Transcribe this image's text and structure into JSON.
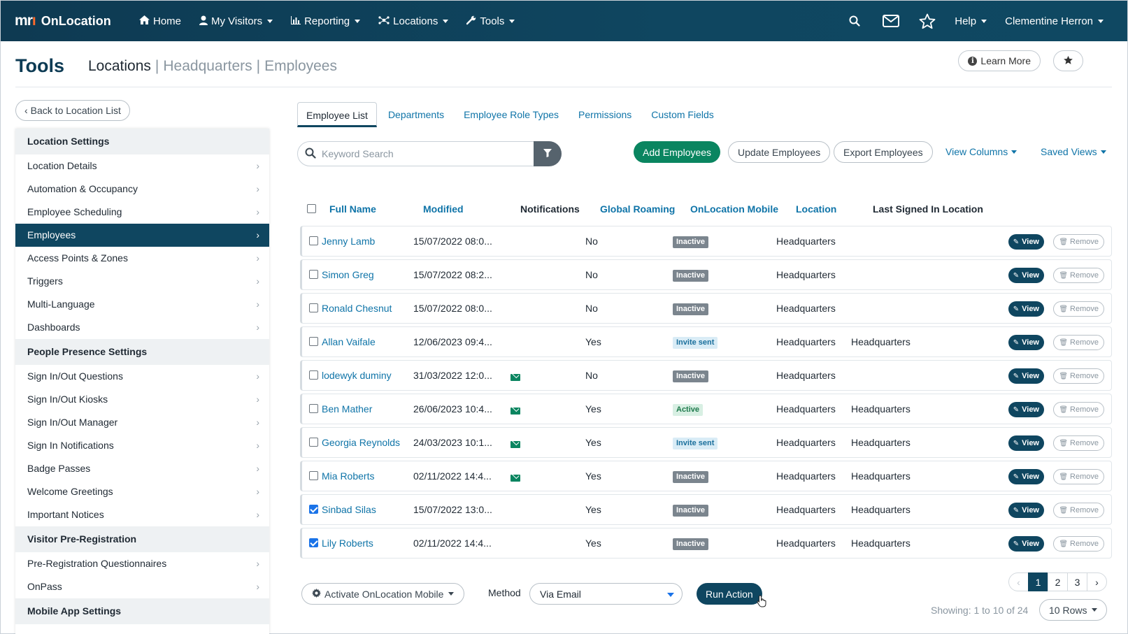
{
  "nav": {
    "brand_logo": "mri",
    "brand_name": "OnLocation",
    "items": [
      {
        "label": "Home",
        "icon": "home-icon",
        "dropdown": false
      },
      {
        "label": "My Visitors",
        "icon": "user-icon",
        "dropdown": true
      },
      {
        "label": "Reporting",
        "icon": "bar-chart-icon",
        "dropdown": true
      },
      {
        "label": "Locations",
        "icon": "network-icon",
        "dropdown": true
      },
      {
        "label": "Tools",
        "icon": "wrench-icon",
        "dropdown": true
      }
    ],
    "help_label": "Help",
    "user_name": "Clementine Herron"
  },
  "header": {
    "title": "Tools",
    "crumb_current": "Locations",
    "crumb_location": "Headquarters",
    "crumb_section": "Employees",
    "learn_more": "Learn More"
  },
  "sidebar": {
    "back_label": "Back to Location List",
    "groups": [
      {
        "heading": "Location Settings",
        "items": [
          "Location Details",
          "Automation & Occupancy",
          "Employee Scheduling",
          "Employees",
          "Access Points & Zones",
          "Triggers",
          "Multi-Language",
          "Dashboards"
        ]
      },
      {
        "heading": "People Presence Settings",
        "items": [
          "Sign In/Out Questions",
          "Sign In/Out Kiosks",
          "Sign In/Out Manager",
          "Sign In Notifications",
          "Badge Passes",
          "Welcome Greetings",
          "Important Notices"
        ]
      },
      {
        "heading": "Visitor Pre-Registration",
        "items": [
          "Pre-Registration Questionnaires",
          "OnPass"
        ]
      },
      {
        "heading": "Mobile App Settings",
        "items": []
      }
    ],
    "active_item": "Employees"
  },
  "tabs": [
    {
      "label": "Employee List",
      "active": true
    },
    {
      "label": "Departments",
      "active": false
    },
    {
      "label": "Employee Role Types",
      "active": false
    },
    {
      "label": "Permissions",
      "active": false
    },
    {
      "label": "Custom Fields",
      "active": false
    }
  ],
  "toolbar": {
    "search_placeholder": "Keyword Search",
    "add_label": "Add Employees",
    "update_label": "Update Employees",
    "export_label": "Export Employees",
    "view_columns_label": "View Columns",
    "saved_views_label": "Saved Views"
  },
  "table": {
    "columns": [
      "Full Name",
      "Modified",
      "Notifications",
      "Global Roaming",
      "OnLocation Mobile",
      "Location",
      "Last Signed In Location"
    ],
    "view_label": "View",
    "remove_label": "Remove",
    "rows": [
      {
        "name": "Jenny Lamb",
        "modified": "15/07/2022 08:0...",
        "notify": false,
        "roaming": "No",
        "mobile": "Inactive",
        "location": "Headquarters",
        "last": "",
        "checked": false
      },
      {
        "name": "Simon Greg",
        "modified": "15/07/2022 08:2...",
        "notify": false,
        "roaming": "No",
        "mobile": "Inactive",
        "location": "Headquarters",
        "last": "",
        "checked": false
      },
      {
        "name": "Ronald Chesnut",
        "modified": "15/07/2022 08:0...",
        "notify": false,
        "roaming": "No",
        "mobile": "Inactive",
        "location": "Headquarters",
        "last": "",
        "checked": false
      },
      {
        "name": "Allan Vaifale",
        "modified": "12/06/2023 09:4...",
        "notify": false,
        "roaming": "Yes",
        "mobile": "Invite sent",
        "location": "Headquarters",
        "last": "Headquarters",
        "checked": false
      },
      {
        "name": "lodewyk duminy",
        "modified": "31/03/2022 12:0...",
        "notify": true,
        "roaming": "No",
        "mobile": "Inactive",
        "location": "Headquarters",
        "last": "",
        "checked": false
      },
      {
        "name": "Ben Mather",
        "modified": "26/06/2023 10:4...",
        "notify": true,
        "roaming": "Yes",
        "mobile": "Active",
        "location": "Headquarters",
        "last": "Headquarters",
        "checked": false
      },
      {
        "name": "Georgia Reynolds",
        "modified": "24/03/2023 10:1...",
        "notify": true,
        "roaming": "Yes",
        "mobile": "Invite sent",
        "location": "Headquarters",
        "last": "Headquarters",
        "checked": false
      },
      {
        "name": "Mia Roberts",
        "modified": "02/11/2022 14:4...",
        "notify": true,
        "roaming": "Yes",
        "mobile": "Inactive",
        "location": "Headquarters",
        "last": "Headquarters",
        "checked": false
      },
      {
        "name": "Sinbad Silas",
        "modified": "15/07/2022 13:0...",
        "notify": false,
        "roaming": "Yes",
        "mobile": "Inactive",
        "location": "Headquarters",
        "last": "Headquarters",
        "checked": true
      },
      {
        "name": "Lily Roberts",
        "modified": "02/11/2022 14:4...",
        "notify": false,
        "roaming": "Yes",
        "mobile": "Inactive",
        "location": "Headquarters",
        "last": "Headquarters",
        "checked": true
      }
    ]
  },
  "bottom": {
    "action_label": "Activate OnLocation Mobile",
    "method_label": "Method",
    "method_value": "Via Email",
    "run_label": "Run Action",
    "pages": [
      "1",
      "2",
      "3"
    ],
    "current_page": "1",
    "showing": "Showing: 1 to 10 of 24",
    "rows_label": "10 Rows"
  },
  "colors": {
    "nav_bg": "#0f4660",
    "accent_green": "#0a8560",
    "link_blue": "#0f74a8"
  }
}
